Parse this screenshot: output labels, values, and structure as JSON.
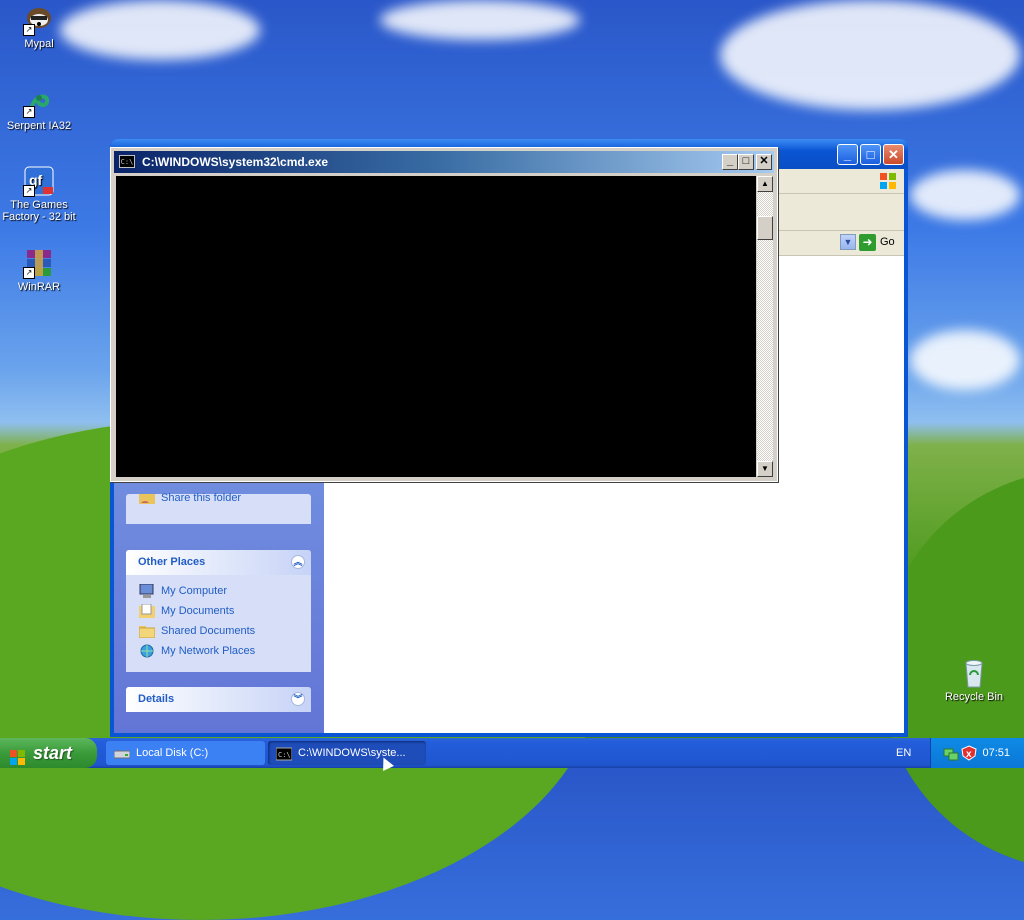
{
  "desktop": {
    "icons": [
      {
        "label": "Mypal",
        "icon": "raccoon-icon"
      },
      {
        "label": "Serpent IA32",
        "icon": "serpent-icon"
      },
      {
        "label": "The Games Factory - 32 bit",
        "icon": "games-factory-icon"
      },
      {
        "label": "WinRAR",
        "icon": "winrar-icon"
      },
      {
        "label": "Recycle Bin",
        "icon": "recycle-bin-icon"
      }
    ]
  },
  "explorer": {
    "address_go_label": "Go",
    "other_places": {
      "title": "Other Places",
      "items": [
        "My Computer",
        "My Documents",
        "Shared Documents",
        "My Network Places"
      ]
    },
    "details": {
      "title": "Details"
    },
    "partial_task_label": "Share this folder"
  },
  "cmd": {
    "title": "C:\\WINDOWS\\system32\\cmd.exe",
    "icon_text": "C:\\"
  },
  "taskbar": {
    "start_label": "start",
    "tasks": [
      {
        "label": "Local Disk (C:)",
        "icon": "drive-icon"
      },
      {
        "label": "C:\\WINDOWS\\syste...",
        "icon": "cmd-icon"
      }
    ],
    "language": "EN",
    "clock": "07:51"
  },
  "colors": {
    "xp_blue": "#0a55d4",
    "console_bg": "#000000",
    "task_active": "#1e4cb8",
    "start_green": "#3a9b3a"
  }
}
